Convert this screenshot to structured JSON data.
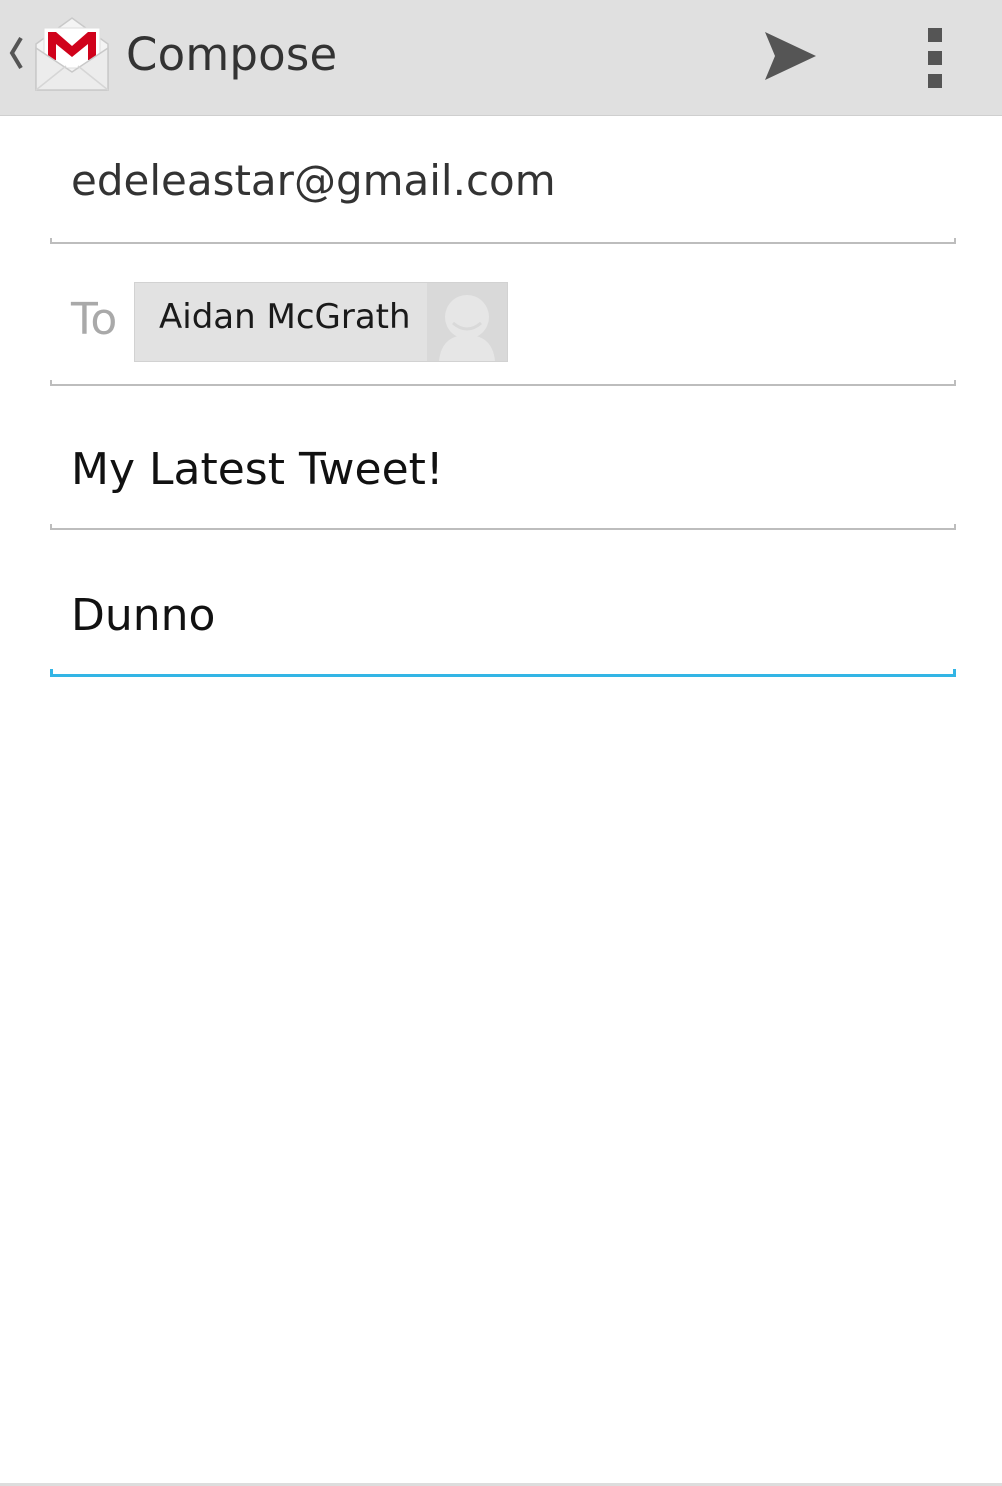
{
  "action_bar": {
    "title": "Compose",
    "back_icon": "chevron-left-icon",
    "app_icon": "gmail-icon",
    "send_icon": "send-icon",
    "overflow_icon": "overflow-menu-icon",
    "background_color": "#e0e0e0",
    "gmail_red": "#d0021b"
  },
  "compose": {
    "from": "edeleastar@gmail.com",
    "to_label": "To",
    "recipients": [
      {
        "name": "Aidan McGrath",
        "avatar_icon": "contact-placeholder-icon"
      }
    ],
    "subject": "My Latest Tweet!",
    "body": "Dunno",
    "focus_color": "#33b5e5",
    "underline_color": "#bdbdbd"
  }
}
